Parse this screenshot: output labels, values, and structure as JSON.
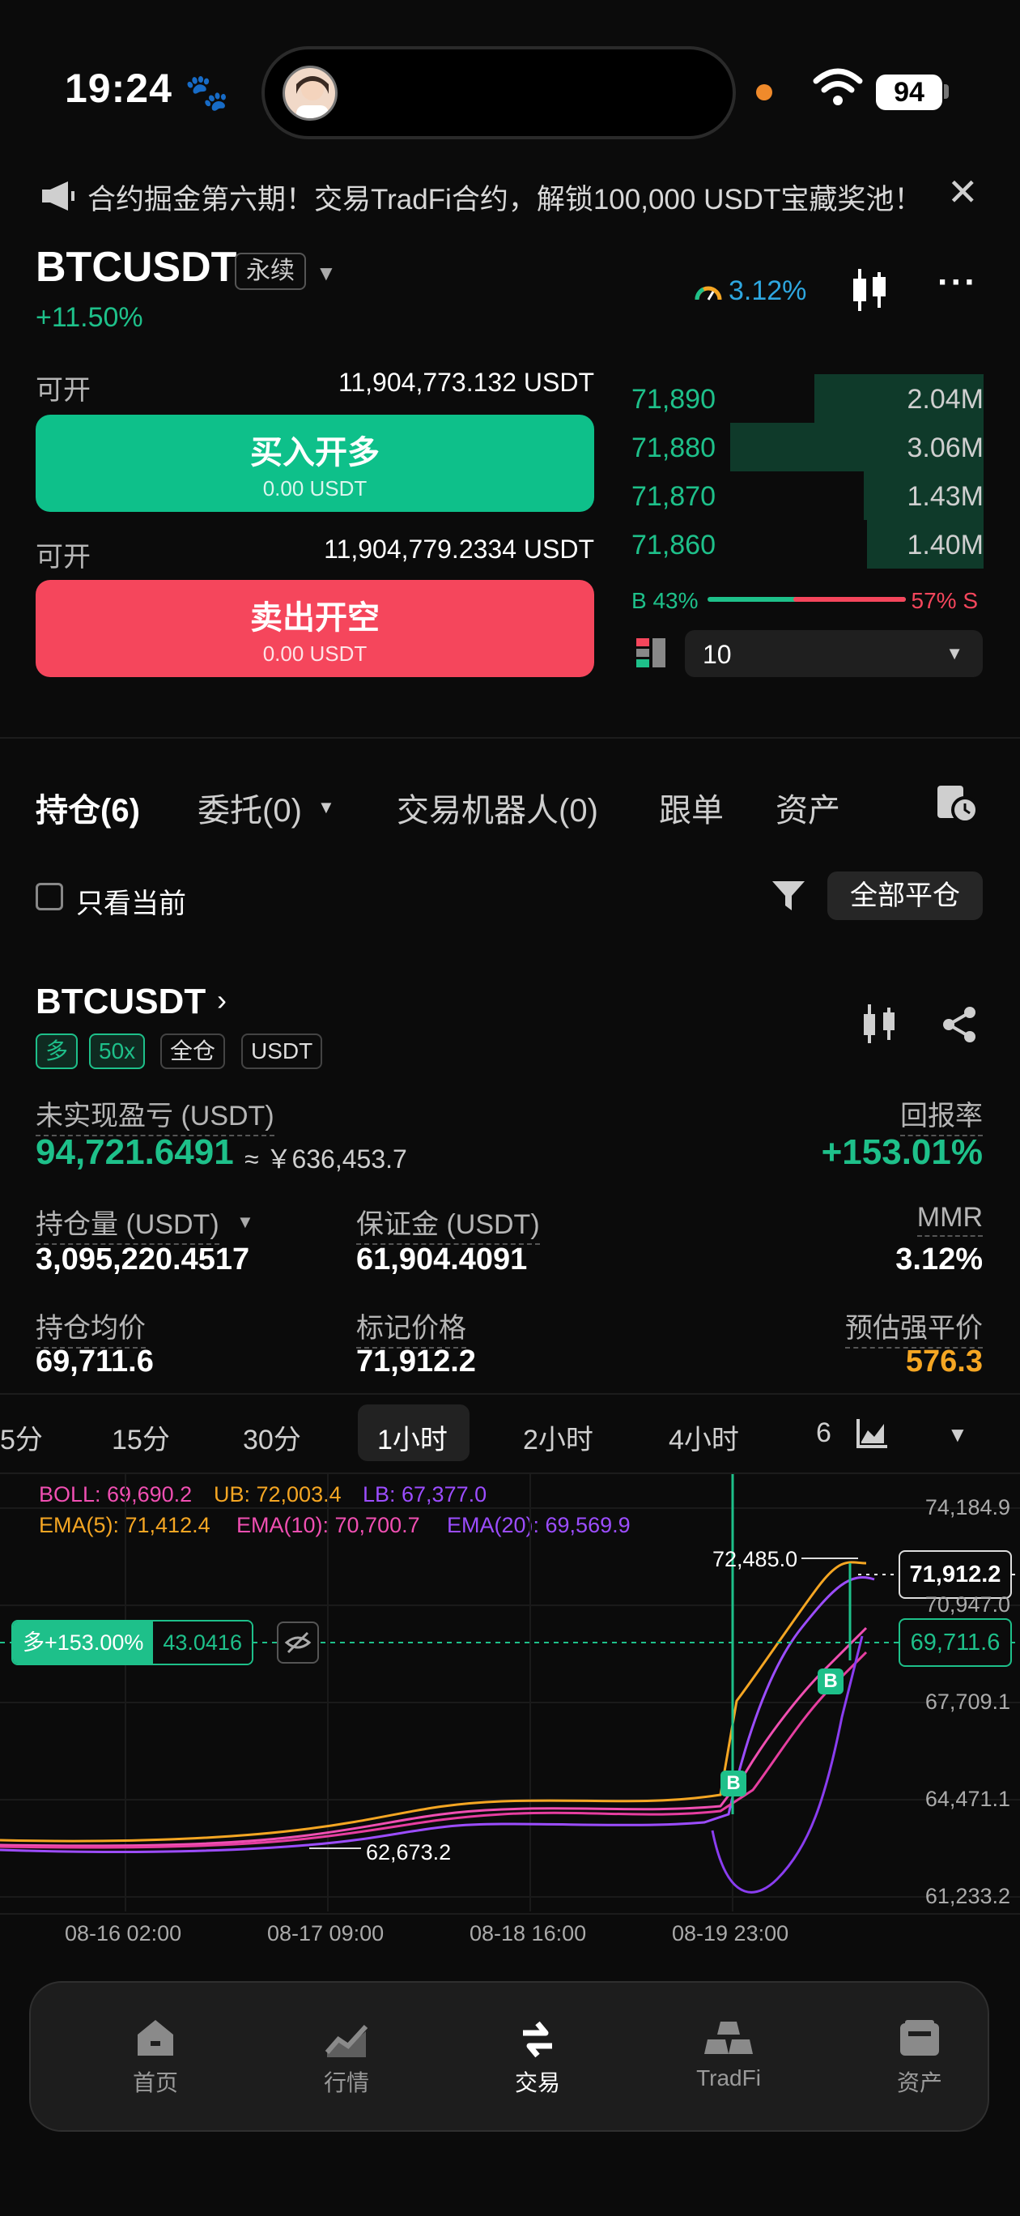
{
  "status": {
    "time": "19:24",
    "battery": "94"
  },
  "banner": {
    "text": "合约掘金第六期！交易TradFi合约，解锁100,000 USDT宝藏奖池！"
  },
  "header": {
    "symbol": "BTCUSDT",
    "tag": "永续",
    "change": "+11.50%",
    "mmr": "3.12%"
  },
  "trade": {
    "avail_label": "可开",
    "buy_avail": "11,904,773.132 USDT",
    "buy_label": "买入开多",
    "buy_amount": "0.00 USDT",
    "sell_avail": "11,904,779.2334 USDT",
    "sell_label": "卖出开空",
    "sell_amount": "0.00 USDT"
  },
  "orderbook": {
    "rows": [
      {
        "price": "71,890",
        "qty": "2.04M",
        "depth": 0.48
      },
      {
        "price": "71,880",
        "qty": "3.06M",
        "depth": 0.72
      },
      {
        "price": "71,870",
        "qty": "1.43M",
        "depth": 0.34
      },
      {
        "price": "71,860",
        "qty": "1.40M",
        "depth": 0.33
      }
    ],
    "buy_pct": "B 43%",
    "sell_pct": "57% S",
    "depth_select": "10"
  },
  "tabs": {
    "positions": "持仓(6)",
    "orders": "委托(0)",
    "bots": "交易机器人(0)",
    "copy": "跟单",
    "assets": "资产"
  },
  "filter": {
    "only_current": "只看当前",
    "close_all": "全部平仓"
  },
  "position": {
    "symbol": "BTCUSDT",
    "chips": [
      "多",
      "50x",
      "全仓",
      "USDT"
    ],
    "pnl_label": "未实现盈亏 (USDT)",
    "pnl": "94,721.6491",
    "pnl_cny": "≈ ￥636,453.7",
    "roe_label": "回报率",
    "roe": "+153.01%",
    "size_label": "持仓量 (USDT)",
    "size": "3,095,220.4517",
    "margin_label": "保证金 (USDT)",
    "margin": "61,904.4091",
    "mmr_label": "MMR",
    "mmr": "3.12%",
    "entry_label": "持仓均价",
    "entry": "69,711.6",
    "mark_label": "标记价格",
    "mark": "71,912.2",
    "liq_label": "预估强平价",
    "liq": "576.3"
  },
  "timeframes": [
    "5分",
    "15分",
    "30分",
    "1小时",
    "2小时",
    "4小时",
    "6"
  ],
  "indicators": {
    "boll": "BOLL: 69,690.2",
    "ub": "UB: 72,003.4",
    "lb": "LB: 67,377.0",
    "ema5": "EMA(5): 71,412.4",
    "ema10": "EMA(10): 70,700.7",
    "ema20": "EMA(20): 69,569.9"
  },
  "chart_data": {
    "type": "line",
    "y_ticks": [
      "74,184.9",
      "70,947.0",
      "67,709.1",
      "64,471.1",
      "61,233.2"
    ],
    "x_ticks": [
      "08-16 02:00",
      "08-17 09:00",
      "08-18 16:00",
      "08-19 23:00"
    ],
    "high_label": "72,485.0",
    "low_label": "62,673.2",
    "last_price": "71,912.2",
    "entry_price": "69,711.6",
    "position_tag": "多+153.00%",
    "position_qty": "43.0416",
    "ylim": [
      61233.2,
      74184.9
    ]
  },
  "nav": [
    "首页",
    "行情",
    "交易",
    "TradFi",
    "资产"
  ]
}
